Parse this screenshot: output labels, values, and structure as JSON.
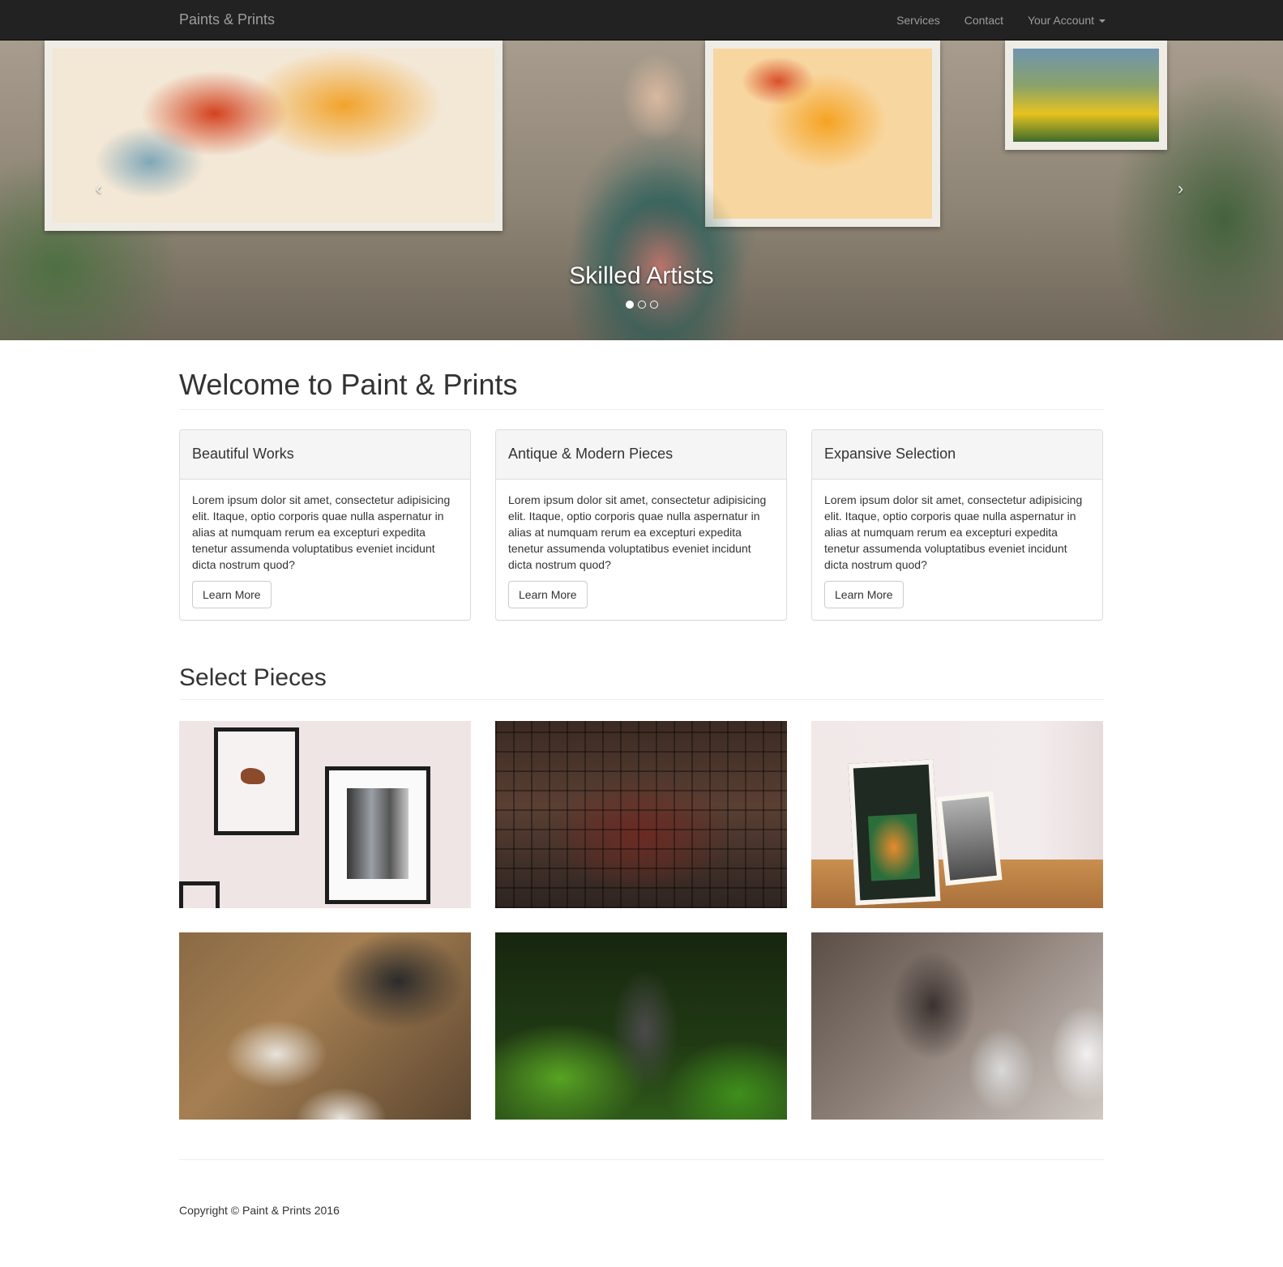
{
  "navbar": {
    "brand": "Paints & Prints",
    "links": [
      "Services",
      "Contact",
      "Your Account"
    ]
  },
  "carousel": {
    "caption": "Skilled Artists",
    "prev_icon": "‹",
    "next_icon": "›",
    "slide_count": 3,
    "active_index": 0
  },
  "welcome": {
    "title": "Welcome to Paint & Prints",
    "panels": [
      {
        "heading": "Beautiful Works",
        "body": "Lorem ipsum dolor sit amet, consectetur adipisicing elit. Itaque, optio corporis quae nulla aspernatur in alias at numquam rerum ea excepturi expedita tenetur assumenda voluptatibus eveniet incidunt dicta nostrum quod?",
        "button": "Learn More"
      },
      {
        "heading": "Antique & Modern Pieces",
        "body": "Lorem ipsum dolor sit amet, consectetur adipisicing elit. Itaque, optio corporis quae nulla aspernatur in alias at numquam rerum ea excepturi expedita tenetur assumenda voluptatibus eveniet incidunt dicta nostrum quod?",
        "button": "Learn More"
      },
      {
        "heading": "Expansive Selection",
        "body": "Lorem ipsum dolor sit amet, consectetur adipisicing elit. Itaque, optio corporis quae nulla aspernatur in alias at numquam rerum ea excepturi expedita tenetur assumenda voluptatibus eveniet incidunt dicta nostrum quod?",
        "button": "Learn More"
      }
    ]
  },
  "gallery": {
    "title": "Select Pieces"
  },
  "footer": {
    "copyright": "Copyright © Paint & Prints 2016"
  },
  "colors": {
    "navbar_bg": "#222222",
    "navbar_text": "#9d9d9d",
    "panel_heading_bg": "#f5f5f5",
    "border": "#dddddd"
  }
}
